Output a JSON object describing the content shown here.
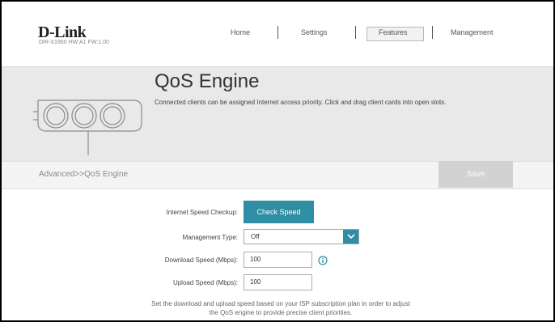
{
  "header": {
    "brand": "D-Link",
    "model": "DIR-X1860 HW:A1 FW:1.00",
    "nav": [
      {
        "label": "Home",
        "active": false
      },
      {
        "label": "Settings",
        "active": false
      },
      {
        "label": "Features",
        "active": true
      },
      {
        "label": "Management",
        "active": false
      }
    ]
  },
  "banner": {
    "title": "QoS Engine",
    "description": "Connected clients can be assigned Internet access priority. Click and drag client cards into open slots."
  },
  "breadcrumb": "Advanced>>QoS Engine",
  "save_label": "Save",
  "form": {
    "speed_check_label": "Internet Speed Checkup:",
    "check_speed_button": "Check Speed",
    "management_type_label": "Management Type:",
    "management_type_value": "Off",
    "download_label": "Download Speed (Mbps):",
    "download_value": "100",
    "upload_label": "Upload Speed (Mbps):",
    "upload_value": "100"
  },
  "note": {
    "line1": "Set the download and upload speed based on your ISP subscription plan in order to adjust",
    "line2": "the QoS engine to provide precise client priorities."
  },
  "colors": {
    "accent": "#2f8ea3",
    "save_disabled": "#d2d2d2",
    "banner_bg": "#e9e9e9"
  },
  "icons": {
    "dropdown": "chevron-down-icon",
    "info": "info-icon",
    "illustration": "qos-gauge-illustration"
  }
}
